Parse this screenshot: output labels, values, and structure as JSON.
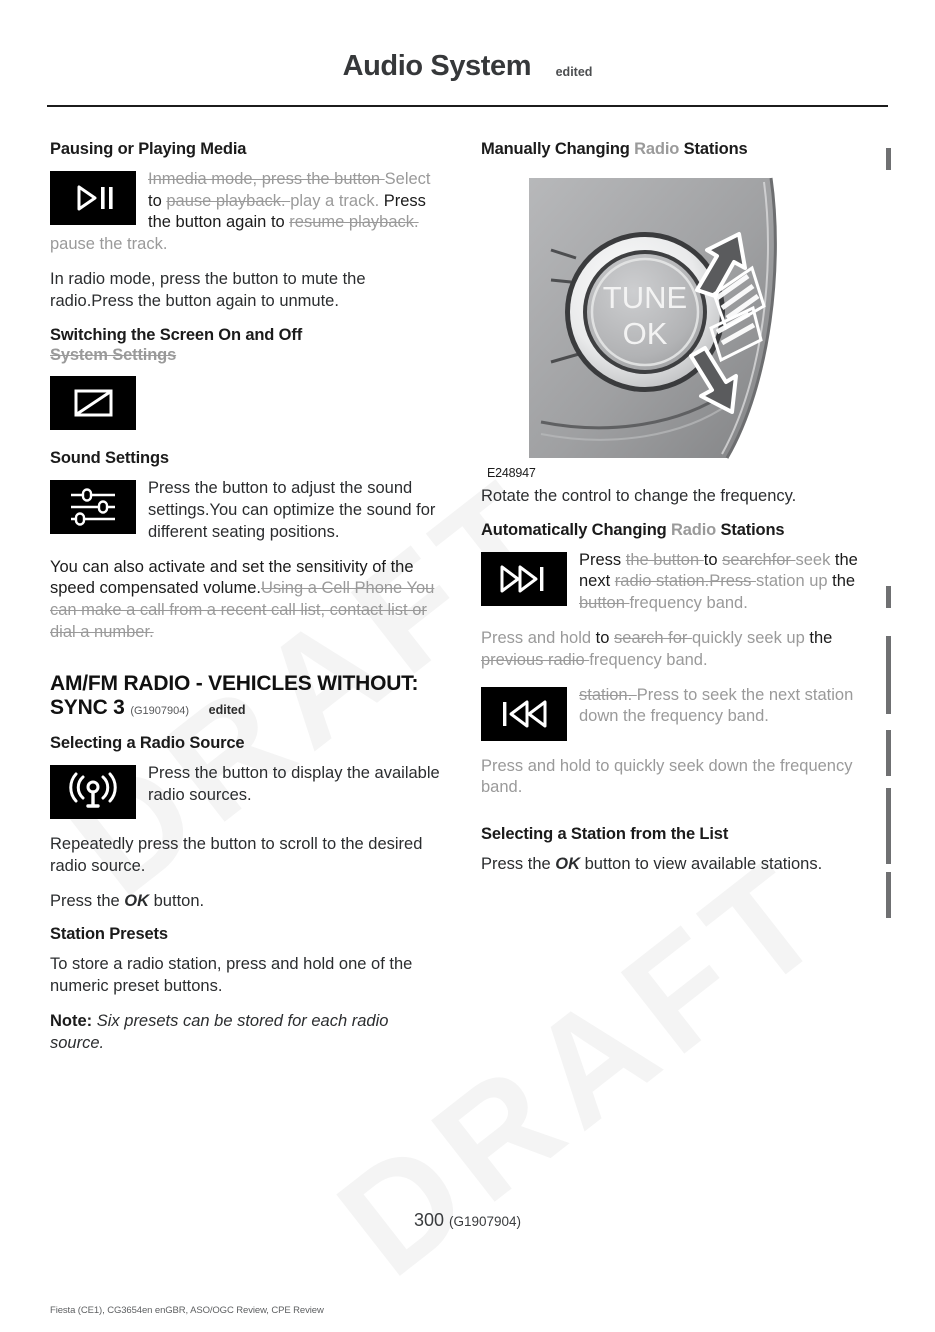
{
  "header": {
    "title": "Audio System",
    "edited_tag": "edited"
  },
  "left_column": {
    "pausing_heading": "Pausing or Playing Media",
    "pausing_block": {
      "icon": "play-pause-icon",
      "runs": [
        {
          "text": "Inmedia mode, press the button ",
          "mode": "del"
        },
        {
          "text": "Select ",
          "mode": "ins-gray"
        },
        {
          "text": " to ",
          "mode": "kept"
        },
        {
          "text": "pause playback. ",
          "mode": "del"
        },
        {
          "text": " play a track. ",
          "mode": "ins-gray"
        },
        {
          "text": " Press the button again",
          "mode": "kept"
        },
        {
          "text": " to ",
          "mode": "kept"
        },
        {
          "text": "resume playback. ",
          "mode": "del"
        },
        {
          "text": " pause the track.",
          "mode": "ins-gray"
        }
      ]
    },
    "radio_mute_paragraph": "In radio mode, press the button to mute the radio.Press the button again to unmute.",
    "switching_heading_kept": "Switching the Screen On and Off",
    "switching_heading_deleted": "System Settings",
    "screen_icon": "screen-off-icon",
    "sound_heading": "Sound Settings",
    "sound_block": {
      "icon": "sound-settings-icon",
      "text": "Press the button to adjust the sound settings.You can optimize the sound for different seating positions."
    },
    "speed_volume_runs": [
      {
        "text": "You can also activate and set the sensitivity of the speed compensated volume.",
        "mode": "kept"
      },
      {
        "text": "Using a Cell Phone ",
        "mode": "del"
      },
      {
        "text": " You can make a call from a recent call list, contact list or dial a number.",
        "mode": "del"
      }
    ],
    "amfm_heading": "AM/FM RADIO - VEHICLES WITHOUT: SYNC 3",
    "amfm_gid": "(G1907904)",
    "amfm_edited": "edited",
    "selecting_source_heading": "Selecting a Radio Source",
    "selecting_source_block": {
      "icon": "radio-source-icon",
      "text": "Press the button to display the available radio sources."
    },
    "repeat_press_paragraph": "Repeatedly press the button to scroll to the desired radio source.",
    "press_ok_prefix": "Press the ",
    "press_ok_bold": "OK",
    "press_ok_suffix": " button.",
    "station_presets_heading": "Station Presets",
    "station_presets_paragraph": "To store a radio station, press and hold one of the numeric preset buttons.",
    "note_label": "Note:",
    "note_text": " Six presets can be stored for each radio source."
  },
  "right_column": {
    "manually_heading_runs": [
      {
        "text": "Manually Changing ",
        "mode": "kept"
      },
      {
        "text": "Radio ",
        "mode": "ins-gray"
      },
      {
        "text": " Stations",
        "mode": "kept"
      }
    ],
    "figure": {
      "label_tune": "TUNE",
      "label_ok": "OK",
      "caption": "E248947",
      "alt": "Steering wheel TUNE OK rotary control with up and down rotation arrows"
    },
    "rotate_paragraph": "Rotate the control to change the frequency.",
    "auto_heading_runs": [
      {
        "text": "Automatically Changing ",
        "mode": "kept"
      },
      {
        "text": "Radio ",
        "mode": "ins-gray"
      },
      {
        "text": "Stations",
        "mode": "kept"
      }
    ],
    "seek_up_block": {
      "icon": "seek-next-icon",
      "runs": [
        {
          "text": "Press ",
          "mode": "kept"
        },
        {
          "text": "the button ",
          "mode": "del"
        },
        {
          "text": " to ",
          "mode": "kept"
        },
        {
          "text": "searchfor ",
          "mode": "del"
        },
        {
          "text": "seek ",
          "mode": "ins-gray"
        },
        {
          "text": " the next ",
          "mode": "kept"
        },
        {
          "text": "radio station.Press ",
          "mode": "del"
        },
        {
          "text": " station ",
          "mode": "ins-gray"
        },
        {
          "text": " up ",
          "mode": "ins-gray"
        },
        {
          "text": " the ",
          "mode": "kept"
        },
        {
          "text": "button ",
          "mode": "del"
        },
        {
          "text": " frequency ",
          "mode": "ins-gray"
        },
        {
          "text": " band.",
          "mode": "ins-gray"
        }
      ]
    },
    "hold_up_runs": [
      {
        "text": "Press and hold ",
        "mode": "ins-gray"
      },
      {
        "text": "to ",
        "mode": "kept"
      },
      {
        "text": "search for ",
        "mode": "del"
      },
      {
        "text": " quickly ",
        "mode": "ins-gray"
      },
      {
        "text": " seek up ",
        "mode": "ins-gray"
      },
      {
        "text": " the ",
        "mode": "kept"
      },
      {
        "text": "previous radio ",
        "mode": "del"
      },
      {
        "text": " frequency ",
        "mode": "ins-gray"
      },
      {
        "text": " band.",
        "mode": "ins-gray"
      }
    ],
    "seek_down_block": {
      "icon": "seek-previous-icon",
      "runs": [
        {
          "text": "station. ",
          "mode": "del"
        },
        {
          "text": " Press to seek the next station down the frequency band.",
          "mode": "ins-gray"
        }
      ]
    },
    "hold_down_paragraph": "Press and hold to quickly seek down the frequency band.",
    "selecting_list_heading": "Selecting a Station from the List",
    "select_list_prefix": "Press the ",
    "select_list_bold": "OK",
    "select_list_suffix": " button to view available stations."
  },
  "footer": {
    "page_number": "300",
    "page_gid": "(G1907904)",
    "note": "Fiesta (CE1), CG3654en enGBR, ASO/OGC Review, CPE Review"
  },
  "colors": {
    "text": "#2b2d2f",
    "heading": "#1b1b1b",
    "tracked": "#9a9a9a",
    "changebar": "#6f7072",
    "icon_bg": "#000000"
  },
  "watermark": {
    "line1": "DRAFT",
    "line2": "DRAFT"
  }
}
